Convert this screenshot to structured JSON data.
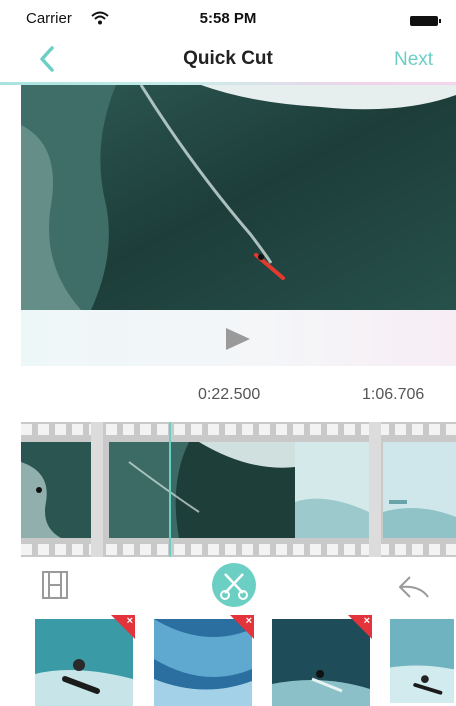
{
  "status_bar": {
    "carrier": "Carrier",
    "time": "5:58 PM"
  },
  "nav": {
    "title": "Quick Cut",
    "next_label": "Next"
  },
  "player": {
    "current_time": "0:22.500",
    "total_time": "1:06.706"
  },
  "timeline": {
    "playhead_fraction": 0.34
  },
  "toolbar": {
    "film_icon": "film-strip-icon",
    "cut_icon": "scissors-icon",
    "undo_icon": "undo-icon"
  },
  "thumbnails": [
    {
      "remove_label": "×"
    },
    {
      "remove_label": "×"
    },
    {
      "remove_label": "×"
    },
    {
      "remove_label": ""
    }
  ],
  "colors": {
    "accent": "#6ccfc4",
    "remove_badge": "#e2343a"
  }
}
